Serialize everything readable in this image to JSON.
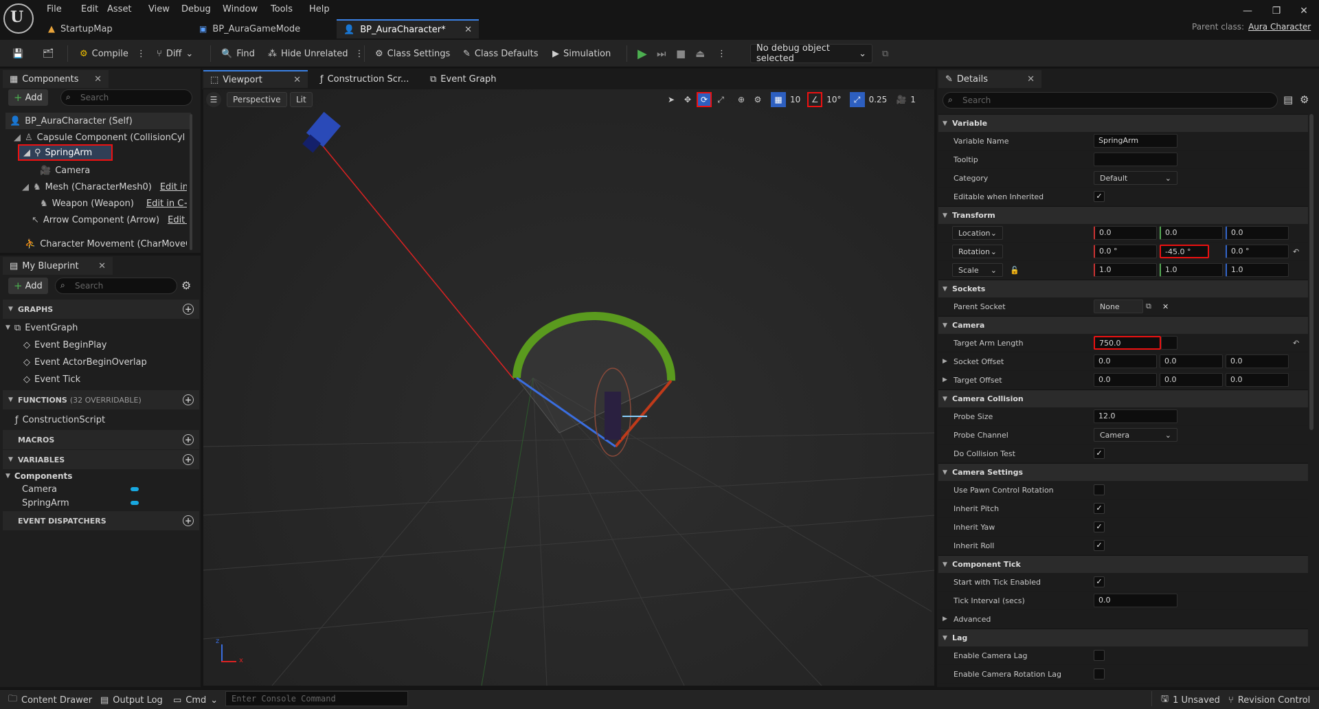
{
  "menu": [
    "File",
    "Edit",
    "Asset",
    "View",
    "Debug",
    "Window",
    "Tools",
    "Help"
  ],
  "tabs": [
    {
      "label": "StartupMap",
      "icon": "level-icon"
    },
    {
      "label": "BP_AuraGameMode",
      "icon": "blueprint-icon"
    },
    {
      "label": "BP_AuraCharacter*",
      "icon": "character-blueprint-icon"
    }
  ],
  "parent_class": {
    "label": "Parent class:",
    "value": "Aura Character"
  },
  "toolbar": {
    "compile": "Compile",
    "diff": "Diff",
    "find": "Find",
    "hide_unrelated": "Hide Unrelated",
    "class_settings": "Class Settings",
    "class_defaults": "Class Defaults",
    "simulation": "Simulation",
    "debug_object": "No debug object selected"
  },
  "components_panel": {
    "title": "Components",
    "add": "Add",
    "search_placeholder": "Search",
    "items": [
      {
        "label": "BP_AuraCharacter (Self)"
      },
      {
        "label": "Capsule Component (CollisionCylinder)"
      },
      {
        "label": "SpringArm"
      },
      {
        "label": "Camera"
      },
      {
        "label": "Mesh (CharacterMesh0)",
        "link": "Edit in C++"
      },
      {
        "label": "Weapon (Weapon)",
        "link": "Edit in C++"
      },
      {
        "label": "Arrow Component (Arrow)",
        "link": "Edit in C++"
      },
      {
        "label": "Character Movement (CharMoveComp)"
      }
    ]
  },
  "my_blueprint": {
    "title": "My Blueprint",
    "add": "Add",
    "search_placeholder": "Search",
    "graphs_hdr": "GRAPHS",
    "event_graph": "EventGraph",
    "events": [
      "Event BeginPlay",
      "Event ActorBeginOverlap",
      "Event Tick"
    ],
    "functions_hdr": "FUNCTIONS",
    "functions_note": "(32 OVERRIDABLE)",
    "construction_script": "ConstructionScript",
    "macros_hdr": "MACROS",
    "variables_hdr": "VARIABLES",
    "components_cat": "Components",
    "variables": [
      "Camera",
      "SpringArm"
    ],
    "dispatchers_hdr": "EVENT DISPATCHERS"
  },
  "editor_tabs": [
    "Viewport",
    "Construction Scr...",
    "Event Graph"
  ],
  "viewport": {
    "perspective": "Perspective",
    "lit": "Lit",
    "grid_snap": "10",
    "rot_snap": "10°",
    "scale_snap": "0.25",
    "cam_speed": "1",
    "axis_x": "x",
    "axis_z": "z"
  },
  "details": {
    "title": "Details",
    "search_placeholder": "Search",
    "variable_hdr": "Variable",
    "variable_name_label": "Variable Name",
    "variable_name": "SpringArm",
    "tooltip_label": "Tooltip",
    "tooltip": "",
    "category_label": "Category",
    "category": "Default",
    "editable_label": "Editable when Inherited",
    "transform_hdr": "Transform",
    "location_label": "Location",
    "location": [
      "0.0",
      "0.0",
      "0.0"
    ],
    "rotation_label": "Rotation",
    "rotation": [
      "0.0 °",
      "-45.0 °",
      "0.0 °"
    ],
    "scale_label": "Scale",
    "scale": [
      "1.0",
      "1.0",
      "1.0"
    ],
    "sockets_hdr": "Sockets",
    "parent_socket_label": "Parent Socket",
    "parent_socket": "None",
    "camera_hdr": "Camera",
    "target_arm_length_label": "Target Arm Length",
    "target_arm_length": "750.0",
    "socket_offset_label": "Socket Offset",
    "socket_offset": [
      "0.0",
      "0.0",
      "0.0"
    ],
    "target_offset_label": "Target Offset",
    "target_offset": [
      "0.0",
      "0.0",
      "0.0"
    ],
    "camera_collision_hdr": "Camera Collision",
    "probe_size_label": "Probe Size",
    "probe_size": "12.0",
    "probe_channel_label": "Probe Channel",
    "probe_channel": "Camera",
    "do_collision_label": "Do Collision Test",
    "camera_settings_hdr": "Camera Settings",
    "use_pawn_label": "Use Pawn Control Rotation",
    "inherit_pitch_label": "Inherit Pitch",
    "inherit_yaw_label": "Inherit Yaw",
    "inherit_roll_label": "Inherit Roll",
    "component_tick_hdr": "Component Tick",
    "start_tick_label": "Start with Tick Enabled",
    "tick_interval_label": "Tick Interval (secs)",
    "tick_interval": "0.0",
    "advanced_label": "Advanced",
    "lag_hdr": "Lag",
    "camera_lag_label": "Enable Camera Lag",
    "camera_rot_lag_label": "Enable Camera Rotation Lag"
  },
  "statusbar": {
    "content_drawer": "Content Drawer",
    "output_log": "Output Log",
    "cmd": "Cmd",
    "console_placeholder": "Enter Console Command",
    "unsaved": "1 Unsaved",
    "revision_control": "Revision Control"
  },
  "colors": {
    "accent": "#3b82e6",
    "highlight_box": "#e11111",
    "play": "#4caf50"
  }
}
